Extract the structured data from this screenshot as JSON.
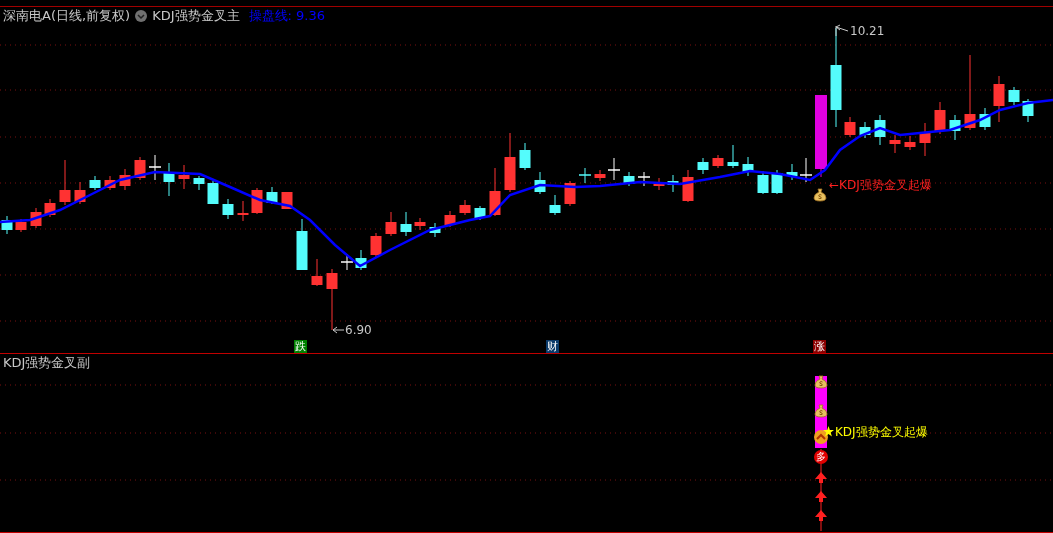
{
  "main_panel": {
    "security": "深南电A(日线,前复权)",
    "indicator": "KDJ强势金叉主",
    "line_reading": "操盘线: 9.36",
    "high_label": "10.21",
    "low_label": "6.90",
    "signal_label": "←KDJ强势金叉起爆",
    "markers": [
      {
        "text": "跌",
        "color": "#008000"
      },
      {
        "text": "财",
        "color": "#0a3a6a"
      },
      {
        "text": "涨",
        "color": "#8b0000"
      }
    ]
  },
  "sub_panel": {
    "indicator": "KDJ强势金叉副",
    "badge": "多",
    "signal_label": "KDJ强势金叉起爆"
  }
}
